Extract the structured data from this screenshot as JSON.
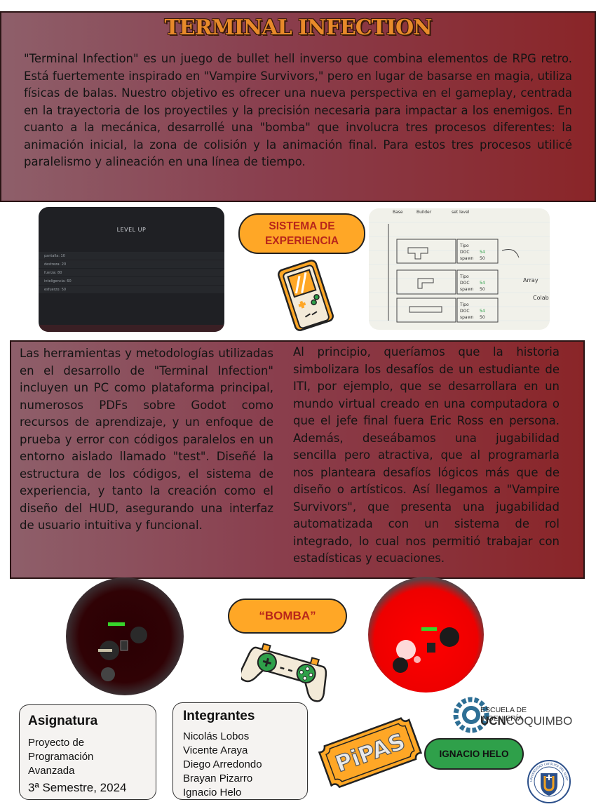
{
  "header": {
    "title": "TERMINAL INFECTION",
    "intro": "\"Terminal Infection\" es un juego de bullet hell inverso que combina elementos de RPG retro. Está fuertemente inspirado en \"Vampire Survivors,\" pero en lugar de basarse en magia, utiliza físicas de balas. Nuestro objetivo es ofrecer una nueva perspectiva en el gameplay, centrada en la trayectoria de los proyectiles y la precisión necesaria para impactar a los enemigos. En cuanto a la mecánica, desarrollé una \"bomba\" que involucra tres procesos diferentes: la animación inicial, la zona de colisión y la animación final. Para estos tres procesos utilicé paralelismo y alineación en una línea de tiempo."
  },
  "screenshot_level_up": {
    "title": "LEVEL UP",
    "rows": [
      "pantalla: 10",
      "destreza: 20",
      "fuerza: 80",
      "inteligencia: 60",
      "esfuerzo: 50"
    ]
  },
  "sketch": {
    "tags": [
      "Tipo",
      "DOC",
      "spawn"
    ],
    "values": [
      "54",
      "50"
    ],
    "headers": [
      "Base",
      "Builder",
      "set level"
    ],
    "side": [
      "Array",
      "Colab"
    ]
  },
  "pill_experiencia": {
    "label": "SISTEMA DE EXPERIENCIA"
  },
  "columns": {
    "left": "Las herramientas y metodologías utilizadas en el desarrollo de \"Terminal Infection\" incluyen un PC como plataforma principal, numerosos PDFs sobre Godot como recursos de aprendizaje, y un enfoque de prueba y error con códigos paralelos en un entorno aislado llamado \"test\". Diseñé la estructura de los códigos, el sistema de experiencia, y tanto la creación como el diseño del HUD, asegurando una interfaz de usuario intuitiva y funcional.",
    "right": "Al principio, queríamos que la historia simbolizara los desafíos de un estudiante de ITI, por ejemplo, que se desarrollara en un mundo virtual creado en una computadora o que el jefe final fuera Eric Ross en persona. Además, deseábamos una jugabilidad sencilla pero atractiva, que al programarla nos planteara desafíos lógicos más que de diseño o artísticos. Así llegamos a \"Vampire Survivors\", que presenta una jugabilidad automatizada con un sistema de rol integrado, lo cual nos permitió trabajar con estadísticas y ecuaciones."
  },
  "pill_bomba": {
    "label": "“BOMBA”"
  },
  "asignatura": {
    "heading": "Asignatura",
    "lines": [
      "Proyecto de",
      "Programación",
      "Avanzada"
    ],
    "semester": "3ª Semestre, 2024"
  },
  "integrantes": {
    "heading": "Integrantes",
    "members": [
      "Nicolás Lobos",
      "Vicente Araya",
      "Diego Arredondo",
      "Brayan Pizarro",
      "Ignacio Helo"
    ]
  },
  "logo_pipas": {
    "text": "PiPAS"
  },
  "pill_name": {
    "label": "IGNACIO HELO"
  },
  "ucn_logo": {
    "line1": "ESCUELA DE INGENIERÍA",
    "line2a": "UCN",
    "line2b": "COQUIMBO"
  },
  "seal": {
    "text": "UNIVERSIDAD CATÓLICA DEL NORTE · CHILE"
  },
  "colors": {
    "accent_orange": "#ffa726",
    "pill_text_red": "#b8261b",
    "name_pill_green": "#2fa04a",
    "box_gradient_start": "#8e5f6a",
    "box_gradient_end": "#8a2528"
  }
}
